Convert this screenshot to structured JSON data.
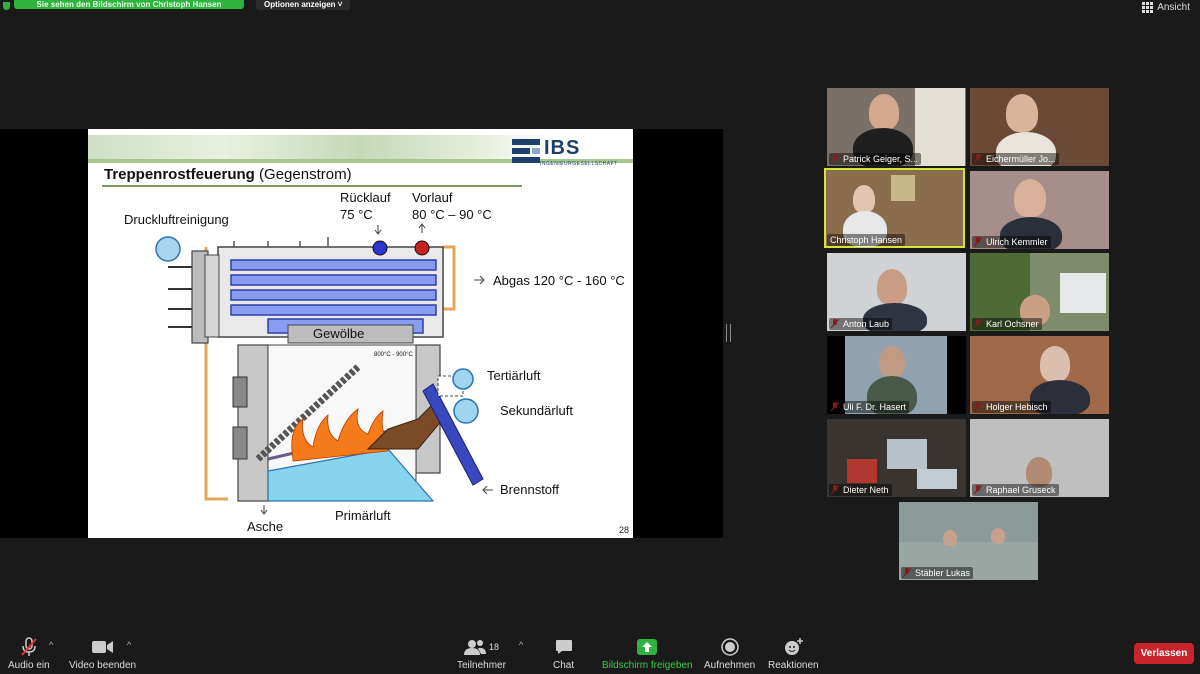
{
  "topbar": {
    "share_banner": "Sie sehen den Bildschirm von Christoph Hansen",
    "options_label": "Optionen anzeigen",
    "view_label": "Ansicht"
  },
  "slide": {
    "title_bold": "Treppenrostfeuerung",
    "title_rest": "(Gegenstrom)",
    "logo_text": "IBS",
    "logo_sub": "INGENIEURGESELLSCHAFT",
    "labels": {
      "druckluft": "Druckluftreinigung",
      "ruecklauf": "Rücklauf",
      "ruecklauf_temp": "75 °C",
      "vorlauf": "Vorlauf",
      "vorlauf_temp": "80 °C – 90 °C",
      "abgas": "Abgas 120 °C - 160 °C",
      "gewoelbe": "Gewölbe",
      "temp_zone": "800°C - 900°C",
      "tertiaer": "Tertiärluft",
      "sekundaer": "Sekundärluft",
      "brennstoff": "Brennstoff",
      "asche": "Asche",
      "primaer": "Primärluft"
    },
    "page_number": "28"
  },
  "participants": [
    {
      "name": "Patrick Geiger, S...",
      "muted": true,
      "active": false
    },
    {
      "name": "Eichermüller Jo...",
      "muted": true,
      "active": false
    },
    {
      "name": "Christoph Hansen",
      "muted": false,
      "active": true
    },
    {
      "name": "Ulrich Kemmler",
      "muted": true,
      "active": false
    },
    {
      "name": "Anton Laub",
      "muted": true,
      "active": false
    },
    {
      "name": "Karl Ochsner",
      "muted": true,
      "active": false
    },
    {
      "name": "Uli F. Dr. Hasert",
      "muted": true,
      "active": false
    },
    {
      "name": "Holger Hebisch",
      "muted": true,
      "active": false
    },
    {
      "name": "Dieter Neth",
      "muted": true,
      "active": false
    },
    {
      "name": "Raphael Gruseck",
      "muted": true,
      "active": false
    },
    {
      "name": "Stäbler Lukas",
      "muted": true,
      "active": false
    }
  ],
  "toolbar": {
    "audio": "Audio ein",
    "video": "Video beenden",
    "participants": "Teilnehmer",
    "participant_count": "18",
    "chat": "Chat",
    "share": "Bildschirm freigeben",
    "record": "Aufnehmen",
    "reactions": "Reaktionen",
    "leave": "Verlassen"
  },
  "colors": {
    "share_green": "#2fb33c",
    "active_speaker": "#d6e33b",
    "leave_red": "#c8242b",
    "background": "#1a1a1a"
  }
}
